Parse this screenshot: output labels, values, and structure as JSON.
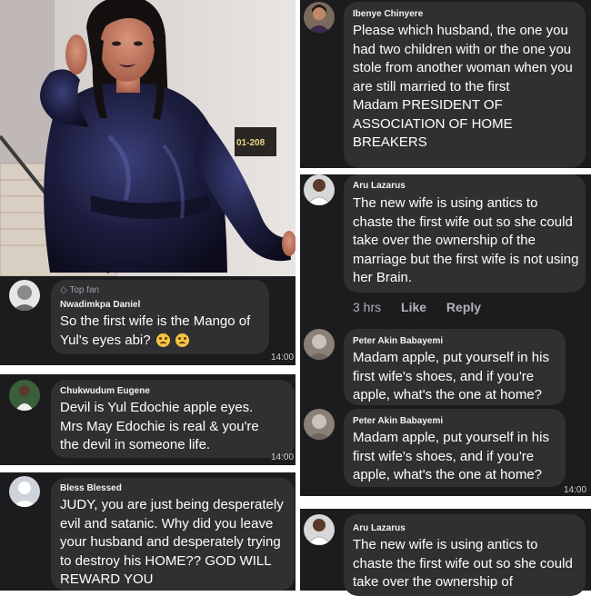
{
  "comments": [
    {
      "name": "Ibenye Chinyere",
      "text": "Please which husband, the one you had two children with or the one you stole from another woman when you are still married to the first\nMadam PRESIDENT OF ASSOCIATION OF HOME BREAKERS",
      "avatar": "avatar-woman-icon"
    },
    {
      "name": "Aru Lazarus",
      "text": "The new wife is using antics to chaste the first wife out so she could take over the ownership of the marriage but the first wife is not using her Brain.",
      "meta": {
        "time": "3 hrs",
        "like": "Like",
        "reply": "Reply"
      },
      "avatar": "avatar-man-icon"
    },
    {
      "badge": "Top fan",
      "name": "Nwadimkpa Daniel",
      "text": "So the first wife is the Mango of Yul's eyes abi?",
      "emoji": "confused-face-emoji",
      "time": "14:00"
    },
    {
      "name": "Chukwudum Eugene",
      "text": "Devil is Yul Edochie apple eyes. Mrs May Edochie is real & you're the devil in someone life.",
      "time": "14:00"
    },
    {
      "name": "Bless Blessed",
      "text": "JUDY, you are just being desperately evil and satanic. Why did you leave your husband and desperately trying to destroy his HOME?? GOD WILL REWARD YOU"
    },
    {
      "name": "Peter Akin Babayemi",
      "text": "Madam apple, put yourself in his first wife's shoes, and if you're apple, what's the one at home?"
    },
    {
      "name": "Peter Akin Babayemi",
      "text": "Madam apple, put yourself in his first wife's shoes, and if you're apple, what's the one at home?",
      "time": "14:00"
    },
    {
      "name": "Aru Lazarus",
      "text": "The new wife is using antics to chaste the first wife out so she could take over the ownership of"
    }
  ],
  "photo": {
    "door_sign": "01-208"
  },
  "colors": {
    "panel": "#1c1c1e",
    "bubble": "#303032",
    "text": "#ffffff",
    "meta": "#b0b3b8",
    "badge": "#9aa0a6"
  }
}
